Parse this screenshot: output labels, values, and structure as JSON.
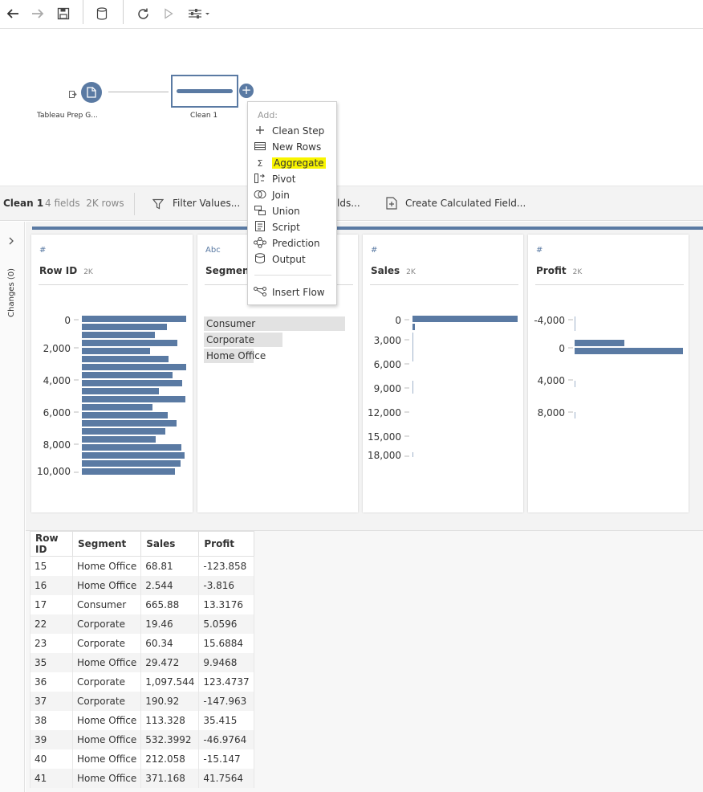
{
  "toolbar": {
    "icons": [
      "back-arrow-icon",
      "forward-arrow-icon",
      "save-icon",
      "database-icon",
      "refresh-icon",
      "run-icon",
      "settings-sliders-icon"
    ]
  },
  "flow": {
    "input_node_label": "Tableau Prep G...",
    "clean_node_label": "Clean 1",
    "add_menu": {
      "header": "Add:",
      "items": [
        "Clean Step",
        "New Rows",
        "Aggregate",
        "Pivot",
        "Join",
        "Union",
        "Script",
        "Prediction",
        "Output"
      ],
      "insert_flow": "Insert Flow"
    }
  },
  "step_bar": {
    "name": "Clean 1",
    "info": "4 fields  2K rows",
    "filter_label": "Filter Values...",
    "fields_label": "lds...",
    "calc_label": "Create Calculated Field..."
  },
  "sidebar": {
    "changes_label": "Changes (0)"
  },
  "profile": {
    "cards": [
      {
        "type": "#",
        "name": "Row ID",
        "count": "2K",
        "ticks": [
          "0",
          "2,000",
          "4,000",
          "6,000",
          "8,000",
          "10,000"
        ]
      },
      {
        "type": "Abc",
        "name": "Segment",
        "values": [
          "Consumer",
          "Corporate",
          "Home Office"
        ]
      },
      {
        "type": "#",
        "name": "Sales",
        "count": "2K",
        "ticks": [
          "0",
          "3,000",
          "6,000",
          "9,000",
          "12,000",
          "15,000",
          "18,000"
        ]
      },
      {
        "type": "#",
        "name": "Profit",
        "count": "2K",
        "ticks": [
          "-4,000",
          "0",
          "4,000",
          "8,000"
        ]
      }
    ]
  },
  "table": {
    "columns": [
      "Row ID",
      "Segment",
      "Sales",
      "Profit"
    ],
    "rows": [
      [
        "15",
        "Home Office",
        "68.81",
        "-123.858"
      ],
      [
        "16",
        "Home Office",
        "2.544",
        "-3.816"
      ],
      [
        "17",
        "Consumer",
        "665.88",
        "13.3176"
      ],
      [
        "22",
        "Corporate",
        "19.46",
        "5.0596"
      ],
      [
        "23",
        "Corporate",
        "60.34",
        "15.6884"
      ],
      [
        "35",
        "Home Office",
        "29.472",
        "9.9468"
      ],
      [
        "36",
        "Corporate",
        "1,097.544",
        "123.4737"
      ],
      [
        "37",
        "Corporate",
        "190.92",
        "-147.963"
      ],
      [
        "38",
        "Home Office",
        "113.328",
        "35.415"
      ],
      [
        "39",
        "Home Office",
        "532.3992",
        "-46.9764"
      ],
      [
        "40",
        "Home Office",
        "212.058",
        "-15.147"
      ],
      [
        "41",
        "Home Office",
        "371.168",
        "41.7564"
      ]
    ]
  }
}
